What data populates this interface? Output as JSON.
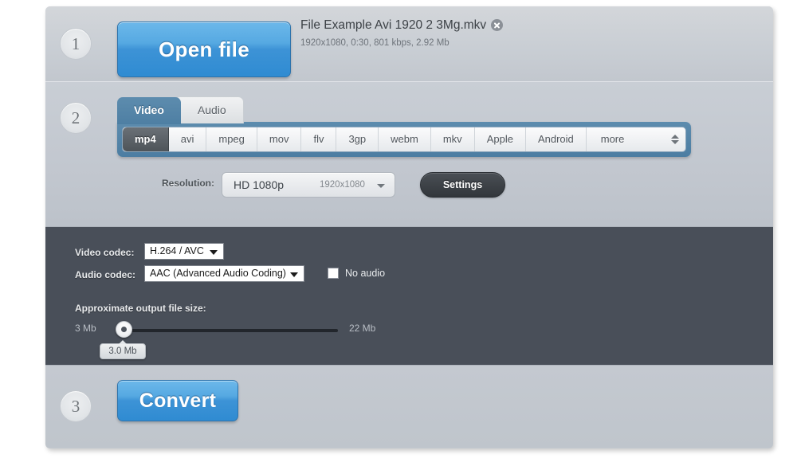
{
  "step1": {
    "number": "1",
    "open_file_label": "Open file",
    "file_name": "File Example Avi 1920 2 3Mg.mkv",
    "file_meta": "1920x1080, 0:30, 801 kbps, 2.92 Mb",
    "clear_icon": "close-circle-icon"
  },
  "step2": {
    "number": "2",
    "tabs": [
      {
        "label": "Video",
        "active": true
      },
      {
        "label": "Audio",
        "active": false
      }
    ],
    "formats": [
      "mp4",
      "avi",
      "mpeg",
      "mov",
      "flv",
      "3gp",
      "webm",
      "mkv",
      "Apple",
      "Android",
      "more"
    ],
    "selected_format": "mp4",
    "stepper_icon": "up-down-stepper-icon",
    "resolution": {
      "label": "Resolution:",
      "value": "HD 1080p",
      "dimensions": "1920x1080",
      "caret_icon": "chevron-down-icon"
    },
    "settings_label": "Settings"
  },
  "settings_panel": {
    "video_codec_label": "Video codec:",
    "video_codec_value": "H.264 / AVC",
    "audio_codec_label": "Audio codec:",
    "audio_codec_value": "AAC (Advanced Audio Coding)",
    "no_audio_label": "No audio",
    "no_audio_checked": false,
    "slider": {
      "title": "Approximate output file size:",
      "min_label": "3 Mb",
      "max_label": "22 Mb",
      "current_label": "3.0 Mb",
      "min": 3,
      "max": 22,
      "value": 3
    }
  },
  "step3": {
    "number": "3",
    "convert_label": "Convert"
  },
  "colors": {
    "accent_blue": "#3d93d6",
    "tab_blue": "#4e7fa3",
    "dark_panel": "#494f59",
    "page_gray": "#c3c8cf"
  }
}
